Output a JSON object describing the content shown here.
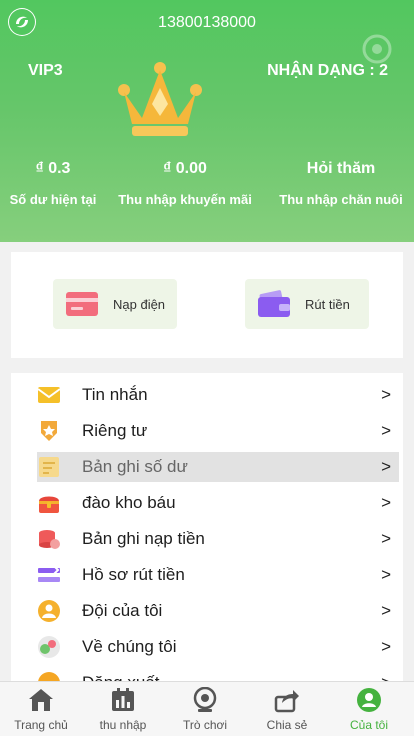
{
  "header": {
    "phone": "13800138000",
    "vip_level": "VIP3",
    "receive_type": "NHẬN DẠNG : 2",
    "stats": [
      {
        "value": "₫ 0.3",
        "label": "Số dư hiện tại"
      },
      {
        "value": "₫ 0.00",
        "label": "Thu nhập khuyến mãi"
      },
      {
        "value": "Hỏi thăm",
        "label": "Thu nhập chăn nuôi"
      }
    ]
  },
  "actions": [
    {
      "label": "Nạp điện",
      "icon": "card-icon"
    },
    {
      "label": "Rút tiền",
      "icon": "wallet-icon"
    }
  ],
  "menu": {
    "items": [
      {
        "label": "Tin nhắn",
        "icon": "envelope-icon"
      },
      {
        "label": "Riêng tư",
        "icon": "medal-icon"
      },
      {
        "label": "Bản ghi số dư",
        "icon": "ledger-icon"
      },
      {
        "label": "đào kho báu",
        "icon": "treasure-chest-icon"
      },
      {
        "label": "Bản ghi nạp tiền",
        "icon": "coins-icon"
      },
      {
        "label": "Hồ sơ rút tiền",
        "icon": "withdraw-icon"
      },
      {
        "label": "Đội của tôi",
        "icon": "team-icon"
      },
      {
        "label": "Về chúng tôi",
        "icon": "about-icon"
      },
      {
        "label": "Đăng xuất",
        "icon": "logout-icon"
      }
    ],
    "chevron": ">"
  },
  "tabbar": {
    "items": [
      {
        "label": "Trang chủ",
        "icon": "home-icon"
      },
      {
        "label": "thu nhập",
        "icon": "chart-icon"
      },
      {
        "label": "Trò chơi",
        "icon": "webcam-icon"
      },
      {
        "label": "Chia sẻ",
        "icon": "share-icon"
      },
      {
        "label": "Của tôi",
        "icon": "profile-icon"
      }
    ],
    "active_index": 4
  },
  "colors": {
    "brand_green": "#52c75f",
    "active_tab": "#45b23f"
  }
}
